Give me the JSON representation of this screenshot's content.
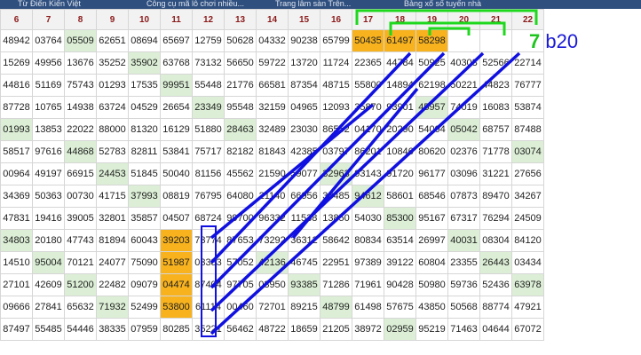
{
  "topbar": {
    "items": [
      "Từ Điển Kiến Việt",
      "Công cụ mã lô chơi nhiều...",
      "Trang lâm sàn Trên...",
      "Bảng xổ số tuyến nhà"
    ]
  },
  "columns": [
    "6",
    "7",
    "8",
    "9",
    "10",
    "11",
    "12",
    "13",
    "14",
    "15",
    "16",
    "17",
    "18",
    "19",
    "20",
    "21",
    "22"
  ],
  "rows": [
    [
      "48942",
      "03764",
      "05509",
      "62651",
      "08694",
      "65697",
      "12759",
      "50628",
      "04332",
      "90238",
      "65799",
      "50435",
      "61497",
      "58298",
      "",
      "",
      ""
    ],
    [
      "15269",
      "49956",
      "13676",
      "35252",
      "35902",
      "63768",
      "73132",
      "56650",
      "59722",
      "13720",
      "11724",
      "22365",
      "44784",
      "50925",
      "40303",
      "52566",
      "22714"
    ],
    [
      "44816",
      "51169",
      "75743",
      "01293",
      "17535",
      "99951",
      "55448",
      "21776",
      "66581",
      "87354",
      "48715",
      "55800",
      "14894",
      "62198",
      "50221",
      "44823",
      "76777"
    ],
    [
      "87728",
      "10765",
      "14938",
      "63724",
      "04529",
      "26654",
      "23349",
      "95548",
      "32159",
      "04965",
      "12093",
      "35870",
      "93901",
      "45957",
      "74019",
      "16083",
      "53874"
    ],
    [
      "01993",
      "13853",
      "22022",
      "88000",
      "81320",
      "16129",
      "51880",
      "28463",
      "32489",
      "23030",
      "86552",
      "04170",
      "20290",
      "54004",
      "05042",
      "68757",
      "87488"
    ],
    [
      "58517",
      "97616",
      "44868",
      "52783",
      "82811",
      "53841",
      "75717",
      "82182",
      "81843",
      "42385",
      "03797",
      "86201",
      "10846",
      "80620",
      "02376",
      "71778",
      "03074"
    ],
    [
      "00964",
      "49197",
      "66915",
      "24453",
      "51845",
      "50040",
      "81156",
      "45562",
      "21590",
      "59077",
      "32963",
      "93143",
      "91720",
      "96177",
      "03096",
      "31221",
      "27656"
    ],
    [
      "34369",
      "50363",
      "00730",
      "41715",
      "37993",
      "08819",
      "76795",
      "64080",
      "21140",
      "66956",
      "38485",
      "94612",
      "58601",
      "68546",
      "07873",
      "89470",
      "34267"
    ],
    [
      "47831",
      "19416",
      "39005",
      "32801",
      "35857",
      "04507",
      "68724",
      "99700",
      "96332",
      "11538",
      "13850",
      "54030",
      "85300",
      "95167",
      "67317",
      "76294",
      "24509"
    ],
    [
      "34803",
      "20180",
      "47743",
      "81894",
      "60043",
      "39203",
      "73774",
      "87653",
      "73292",
      "36312",
      "58642",
      "80834",
      "63514",
      "26997",
      "40031",
      "08304",
      "84120"
    ],
    [
      "14510",
      "95004",
      "70121",
      "24077",
      "75090",
      "51987",
      "03383",
      "57052",
      "42136",
      "46745",
      "22951",
      "97389",
      "39122",
      "60804",
      "23355",
      "26443",
      "03434"
    ],
    [
      "27101",
      "42609",
      "51200",
      "22482",
      "09079",
      "04474",
      "87404",
      "97705",
      "03950",
      "93385",
      "71286",
      "71961",
      "90428",
      "50980",
      "59736",
      "52436",
      "63978"
    ],
    [
      "09666",
      "27841",
      "65632",
      "71932",
      "52499",
      "53800",
      "61114",
      "00460",
      "72701",
      "89215",
      "48799",
      "61498",
      "57675",
      "43850",
      "50568",
      "88774",
      "47921"
    ],
    [
      "87497",
      "55485",
      "54446",
      "38335",
      "07959",
      "80285",
      "35221",
      "56462",
      "48722",
      "18659",
      "21205",
      "38972",
      "02959",
      "95219",
      "71463",
      "04644",
      "67072"
    ]
  ],
  "annotation": {
    "prefix_glyph": "7",
    "label": "b20"
  },
  "colors": {
    "highlight": "#f7b21e",
    "green_cell": "#dcefd6",
    "line_blue": "#1010e0",
    "line_green": "#1ed81e"
  }
}
